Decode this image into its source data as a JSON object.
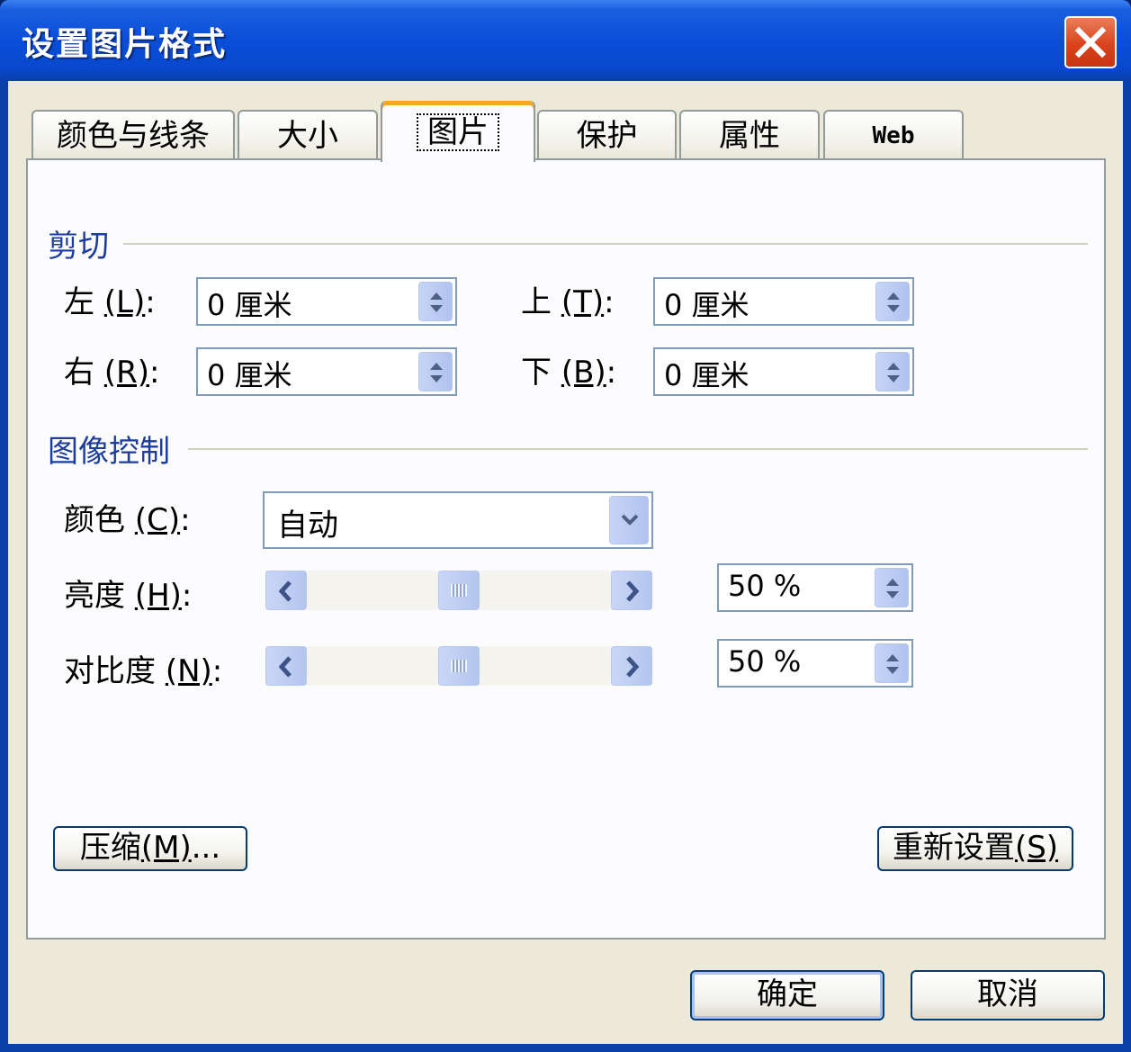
{
  "window": {
    "title": "设置图片格式"
  },
  "tabs": [
    {
      "label": "颜色与线条"
    },
    {
      "label": "大小"
    },
    {
      "label": "图片"
    },
    {
      "label": "保护"
    },
    {
      "label": "属性"
    },
    {
      "label": "Web"
    }
  ],
  "crop": {
    "title": "剪切",
    "left": {
      "label": "左",
      "key": "(L)",
      "colon": ":",
      "value": "0 厘米"
    },
    "top": {
      "label": "上",
      "key": "(T)",
      "colon": ":",
      "value": "0 厘米"
    },
    "right": {
      "label": "右",
      "key": "(R)",
      "colon": ":",
      "value": "0 厘米"
    },
    "bottom": {
      "label": "下",
      "key": "(B)",
      "colon": ":",
      "value": "0 厘米"
    }
  },
  "image_control": {
    "title": "图像控制",
    "color": {
      "label": "颜色",
      "key": "(C)",
      "colon": ":",
      "value": "自动"
    },
    "brightness": {
      "label": "亮度",
      "key": "(H)",
      "colon": ":",
      "value": "50 %",
      "level": 0.5
    },
    "contrast": {
      "label": "对比度",
      "key": "(N)",
      "colon": ":",
      "value": "50 %",
      "level": 0.5
    }
  },
  "buttons": {
    "compress": {
      "label": "压缩",
      "key": "(M)",
      "suffix": "..."
    },
    "reset": {
      "label": "重新设置",
      "key": "(S)"
    },
    "ok": "确定",
    "cancel": "取消"
  },
  "colors": {
    "accent": "#0a4ed8",
    "group_title": "#1d3d9c",
    "face": "#ece9d8",
    "close": "#d9431c"
  }
}
